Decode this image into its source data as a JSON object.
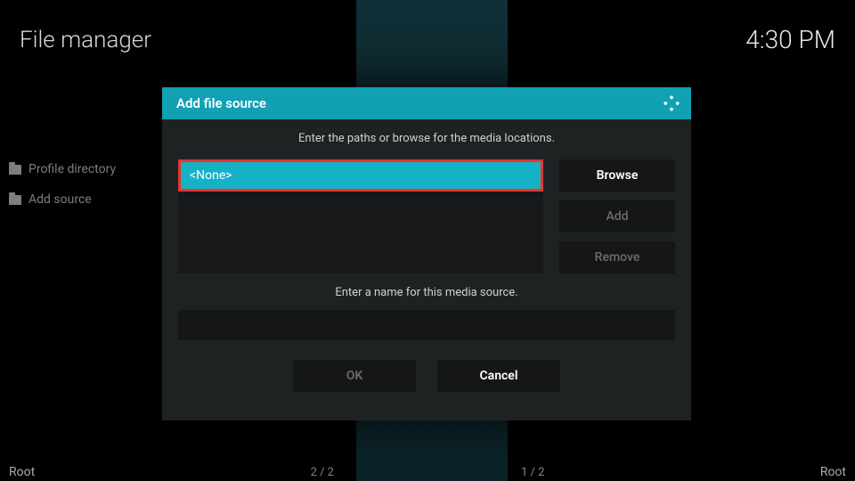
{
  "header": {
    "page_title": "File manager",
    "time": "4:30 PM"
  },
  "sidebar": {
    "items": [
      {
        "label": "Profile directory"
      },
      {
        "label": "Add source"
      }
    ]
  },
  "bottom": {
    "left": "Root",
    "mid_left": "2 / 2",
    "mid_right": "1 / 2",
    "right": "Root"
  },
  "modal": {
    "title": "Add file source",
    "instruction_paths": "Enter the paths or browse for the media locations.",
    "selected_path": "<None>",
    "buttons": {
      "browse": "Browse",
      "add": "Add",
      "remove": "Remove"
    },
    "instruction_name": "Enter a name for this media source.",
    "name_value": "",
    "footer": {
      "ok": "OK",
      "cancel": "Cancel"
    }
  },
  "colors": {
    "accent": "#11a0b4",
    "highlight_border": "#e8352e",
    "panel_bg": "#1f2223",
    "input_bg": "#141617"
  }
}
